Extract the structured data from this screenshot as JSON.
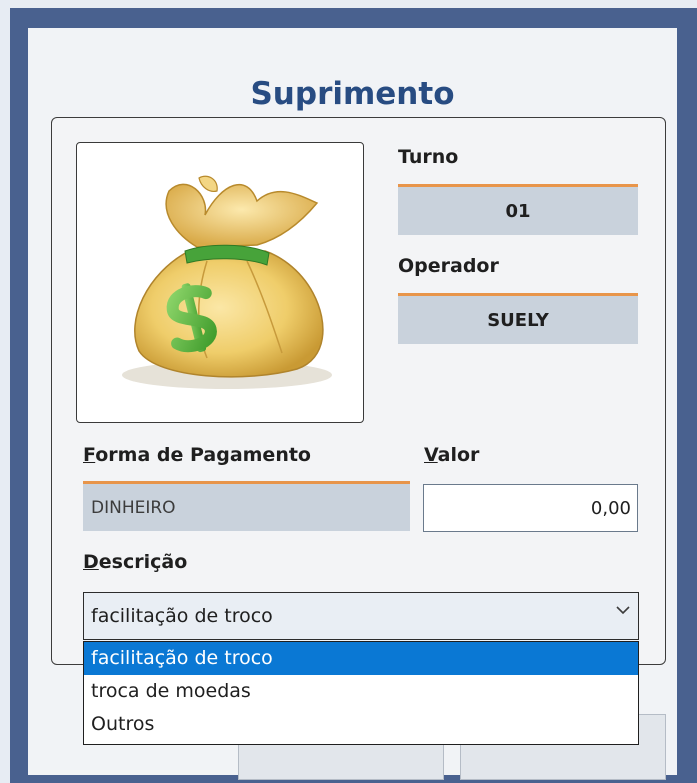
{
  "dialog": {
    "title": "Suprimento"
  },
  "image": {
    "icon": "money-bag-icon"
  },
  "turno": {
    "label": "Turno",
    "value": "01"
  },
  "operador": {
    "label": "Operador",
    "value": "SUELY"
  },
  "forma_pagamento": {
    "label_first": "F",
    "label_rest": "orma de Pagamento",
    "value": "DINHEIRO"
  },
  "valor": {
    "label_first": "V",
    "label_rest": "alor",
    "value": "0,00"
  },
  "descricao": {
    "label_first": "D",
    "label_rest": "escrição",
    "selected": "facilitação de troco",
    "options": [
      "facilitação de troco",
      "troca de moedas",
      "Outros"
    ]
  },
  "colors": {
    "title": "#284c82",
    "accent_border": "#e8954a",
    "readonly_bg": "#c9d2dc",
    "selection": "#0a78d4",
    "frame": "#49618f"
  }
}
